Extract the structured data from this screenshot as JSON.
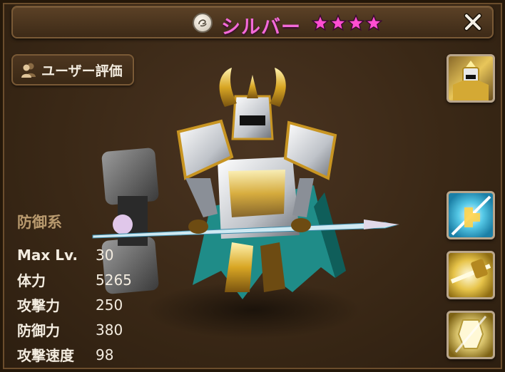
{
  "header": {
    "title": "シルバー",
    "element_icon": "wind-element-icon",
    "star_count": 4,
    "star_color": "#ff4ed2",
    "close_icon": "close-icon"
  },
  "review_button": {
    "label": "ユーザー評価",
    "icon": "users-icon"
  },
  "stats": {
    "type_label": "防御系",
    "rows": [
      {
        "label": "Max Lv.",
        "value": "30"
      },
      {
        "label": "体力",
        "value": "5265"
      },
      {
        "label": "攻撃力",
        "value": "250"
      },
      {
        "label": "防御力",
        "value": "380"
      },
      {
        "label": "攻撃速度",
        "value": "98"
      }
    ]
  },
  "side_icons": [
    {
      "name": "monster-portrait-icon"
    },
    {
      "name": "skill-1-icon"
    },
    {
      "name": "skill-2-icon"
    },
    {
      "name": "skill-3-icon"
    }
  ]
}
